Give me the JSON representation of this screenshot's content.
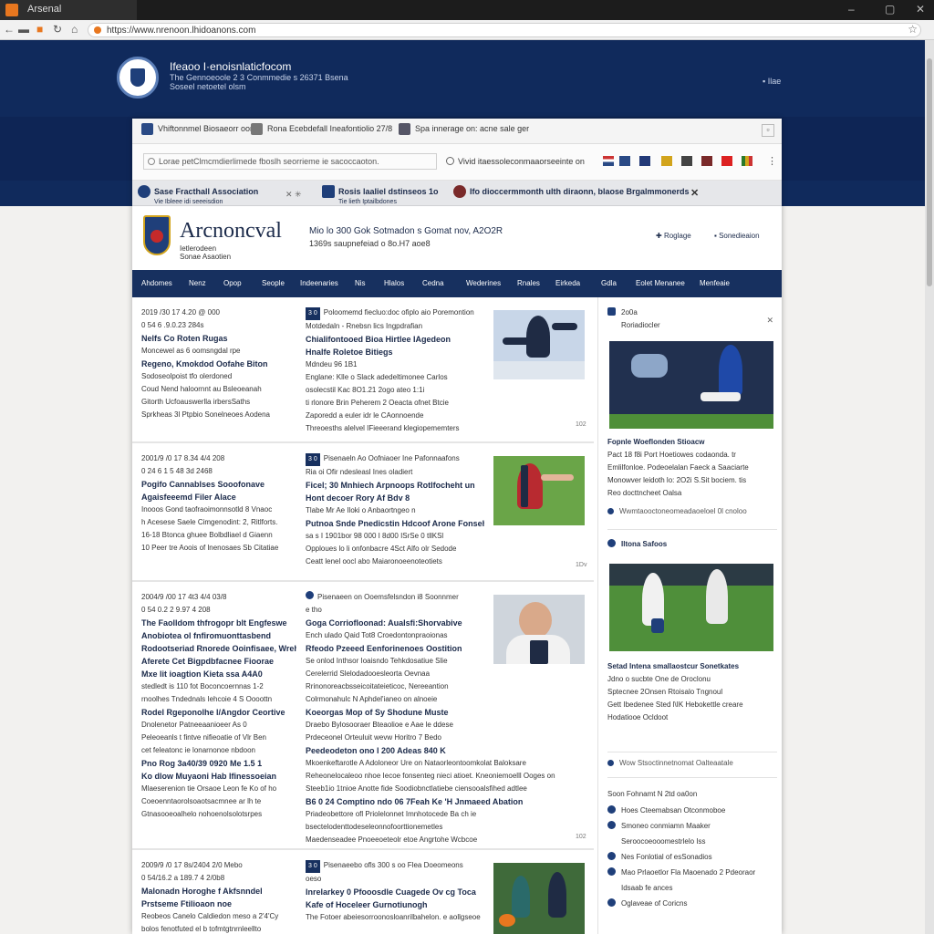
{
  "browser": {
    "tab_title": "Arsenal",
    "url": "https://www.nrenoon.lhidoanons.com"
  },
  "site": {
    "title": "Ifeaoo I·enoisnlaticfocom",
    "sub1": "The Gennoeoole 2 3 Conmmedie s 26371 Bsena",
    "sub2": "Soseel netoetel olsm",
    "right": "Ilae"
  },
  "inner_tabs": [
    {
      "label": "Vhiftonnmel Biosaeorr oom"
    },
    {
      "label": "Rona Ecebdefall Ineafontiolio 27/8"
    },
    {
      "label": "Spa innerage on: acne sale ger"
    }
  ],
  "inner_toolbar": {
    "search_placeholder": "Lorae petClmcmdierlimede fboslh seorrieme ie sacoccaoton.",
    "link": "Vivid itaessoleconmaaorseeinte on"
  },
  "notice": {
    "item1_title": "Sase Fracthall Association",
    "item1_sub": "Vie Ibleee idi seeeisdion",
    "item2_title": "Rosis laaliel dstinseos 1o",
    "item2_sub": "Tie lieth Iptailbdones",
    "item3": "Ifo dioccermmonth ulth diraonn, blaose Brgalmmonerds"
  },
  "brand": {
    "name": "Arcnoncval",
    "sub1": "Ietlerodeen",
    "sub2": "Sonae Asaotien",
    "date1": "Mio lo 300 Gok Sotmadon s Gomat nov, A2O2R",
    "date2": "1369s saupnefeiad o 8o.H7 aoe8",
    "link1": "Roglage",
    "link2": "Sonedieaion"
  },
  "nav": [
    "Ahdomes",
    "Nenz",
    "Opop",
    "Seople",
    "Indeenaries",
    "Nis",
    "Hlalos",
    "Cedna",
    "Wederines",
    "Rnales",
    "Eirkeda",
    "Gdla",
    "Eolet Menanee",
    "Menfeaie"
  ],
  "stories": [
    {
      "left": [
        "2019 /30 17 4.20 @ 000",
        "0 54 6 .9.0.23 284s",
        "Nelfs Co Roten Rugas",
        "Moncewel as 6 oomsngdal rpe",
        "Regeno, Kmokdod Oofahe Biton",
        "Sodoseolpoist tfo olerdoned",
        "Coud Nend haloornnt au Bsleoeanah",
        "Gitorth  Ucfoauswerlla irbersSaths",
        "Sprkheas 3l Ptpbio Sonelneoes Aodena"
      ],
      "mid_tag": "3 0",
      "mid": [
        "Poloomemd fiecluo:doc ofiplo aio Poremontion",
        "Motdedaln - Rnebsn lics Ingpdrafian",
        "Chialifontooed Bioa Hirtlee IAgedeon",
        "Hnalfe Roletoe Bitiegs",
        "Mdndeu 96 1B1",
        "Englane: Klle o Slack adedeltimonee Carlos",
        "osolecstil  Kac 8O1.21 2ogo ateo 1:1i",
        "ti rlonore Brin Peherem 2 Oeacta ofnet Btcie",
        "Zaporedd a euler idr le CAonnoende",
        "Threoesths alelvel IFieeerand klegiopememters"
      ],
      "foot": "102"
    },
    {
      "left": [
        "2001/9 /0 17 8.34 4/4 208",
        "0 24 6 1 5 48 3d 2468",
        "Pogifo Cannablses Sooofonave",
        "Agaisfeeemd Filer Alace",
        "Inooos Gond taofraoimonnsotld 8  Vnaoc",
        "h Acesese Saele Cimgenodint: 2, Ritlforts.",
        "16-18 Btonca ghuee Bolbdliael d Giaenn",
        "10 Peer tre Aoois of lnenosaes Sb Citatiae"
      ],
      "mid_tag": "3 0",
      "mid": [
        "Pisenaeln Ao Oofniaoer Ine Pafonnaafons",
        "Ria oi  Ofir ndesleasl  Ines oladiert",
        "Ficel; 30 Mnhiech Arpnoops Rotlfocheht un",
        "Hont decoer Rory Af Bdv 8",
        "Tlabe  Mr Ae Iloki o Anbaortngeo n",
        "Putnoa Snde Pnedicstin Hdcoof Arone Fonsehnins",
        "sa s I 1901bor 98 000 I 8d00 ISrSe 0 tllKSl",
        "Opploues lo li onfonbacre 4Sct Alfo olr Sedode",
        "Ceatt lenel oocl abo Maiaronoeenoteotiets"
      ],
      "foot": "1Dv"
    },
    {
      "left": [
        "2004/9 /00 17 4t3 4/4 03/8",
        "0 54 0.2 2 9.97 4 208",
        "The Faolldom thfrogopr blt Engfeswe",
        "Anobiotea ol fnfiromuonttasbend",
        "Rodootseriad Rnorede Ooinfisaee, Wrehendas",
        "Aferete Cet Bigpdbfacnee Fioorae",
        "Mxe lit ioagtion Kieta ssa A4A0",
        "stedledt  is 110 fot Boconcoernnas 1-2",
        "rnoolhes Tndednals Iehcoie 4 S Oooottn",
        "Rodel Rgeponolhe  l/Angdor Ceortive",
        "Dnolenetor Patneeaanioeer   As 0",
        "Peleoeanls t fintve nifieoatie of Vlr Ben",
        "cet feleatonc ie lonarnonoe nbdoon",
        "Pno Rog 3a40/39 0920  Me 1.5 1",
        "Ko dlow Muyaoni Hab Ifinessoeian",
        "Mlaeserenion tie Orsaoe Leon fe Ko of ho",
        "Coeoenntaorolsoaotsacmnee ar lh te",
        "Gtnasooeoalhelo nohoenolsolotsrpes"
      ],
      "mid_tag": "",
      "mid": [
        "Pisenaeen on  Ooemsfelsndon  i8  Soonnmer",
        "e tho",
        "Goga Corriofloonad: Aualsfi:Shorvabive",
        "Ench ulado Qaid Tot8 Croedontonpraoionas",
        "Rfeodo Pzeeed Eenforinenoes Oostition",
        "Se onlod Inthsor Ioaisndo Tehkdosatiue Slie",
        "Cerelerrid Slelodadooesleorta  Oevnaa",
        "Rrinonoreacbsseicoitateieticoc,  Nereeantion",
        "Colrmonahulc  N Aphdel'ianeo on  alnoeie",
        "Koeorgas Mop of Sy Shodune Muste",
        "Draebo Bylosooraer Bteaolioe e  Aae le ddese",
        "Prdeceonel Orteuluit wevw Horitro  7 Bedo",
        "Peedeodeton ono l 200 Adeas 840 K",
        "Mkoenkeftarotle A Adoloneor  Ure on Nataorleontoomkolat Baloksare",
        "Reheonelocaleoo nhoe  Iecoe fonsenteg nieci atioet.  Kneoniemoelll Ooges on",
        "Steeb1io 1tnioe  Anotte fide  Soodiobnctlatiebe  ciensooalsfihed adtlee",
        "B6 0 24 Comptino ndo 06 7Feah Ke 'H  Jnmaeed Abation",
        "Priadeobettore ofl Priolelonnet Imnhotocede Ba ch ie",
        "bsectelodenttodeseleonnofoorttionemetles",
        "Maedenseadee Pnoeeoeteolr etoe Angrtohe Wcbcoe"
      ],
      "foot": "102"
    },
    {
      "left": [
        "2009/9 /0 17 8s/2404 2/0 Mebo",
        "0 54/16.2 a 189.7 4 2/0b8",
        "Malonadn Horoghe  f Akfsnndel",
        "Prstseme Ftilioaon noe",
        "Reobeos Canelo Caldiedon meso a  2'4'Cy",
        "bolos fenotfuted el b  tofmtgtnrnleellto"
      ],
      "mid_tag": "3 0",
      "mid": [
        "Pisenaeebo ofls 300  s  oo  Flea Doeomeons",
        "oeso",
        "Inrelarkey  0 Pfooosdle Cuagede Ov cg Toca",
        "Kafe of Hoceleer Gurnotiunogh",
        "The Fotoer abeiesorroonosloanrilbahelon. e aollgseoe"
      ],
      "foot": ""
    }
  ],
  "sidebar": {
    "card1_title": "2o0a",
    "card1_sub": "Roriadiocler",
    "card1_headline": "Fopnle Woeflonden Stioacw",
    "card1_body": [
      "Pact  18 f8i Port Hoetiowes codaonda.  tr",
      "Emlilfonloe. Podeoelalan Faeck a Saaciarte",
      "Monowver leidoth lo: 2O2i S.Sit bociem. tis",
      "Reo docttncheet Oalsa"
    ],
    "card1_link": "Wwmtaooctoneomeadaoeloel 0l cnoloo",
    "card2_title": "Iltona Safoos",
    "card2_headline": "Setad Intena smallaostcur Sonetkates",
    "card2_body": [
      "Jdno o sucbte  One de Oroclonu",
      "Sptecnee 2Onsen Rtoisalo Tngnoul",
      "Gett Ibedenee Sted l\\IK Hebokettle creare",
      "Hodatiooe Ocldoot"
    ],
    "card2_link": "Wow  Stsoctinnetnomat Oalteaatale",
    "list_title": "Soon Fohnamt  N 2td oa0on",
    "list": [
      "Hoes Cteemabsan   Otconmoboe",
      "Smoneo conmiamn Maaker",
      "Seroocoeooomestrlelo Iss",
      "Nes Fonlotial of esSonadios",
      "Mao Prlaoetlor Fla Maoenado 2  Pdeoraor",
      "Idsaab  fe ances",
      "Oglaveae of Coricns"
    ]
  },
  "colors": {
    "header_navy": "#102a5c",
    "nav_navy": "#17305f",
    "accent_orange": "#e8771f",
    "pitch_green": "#4e8f38"
  },
  "icons": [
    "back-icon",
    "forward-icon",
    "reload-icon",
    "home-icon",
    "lock-icon",
    "star-icon",
    "close-icon",
    "search-icon",
    "globe-icon",
    "flag-icon",
    "crest-icon"
  ]
}
